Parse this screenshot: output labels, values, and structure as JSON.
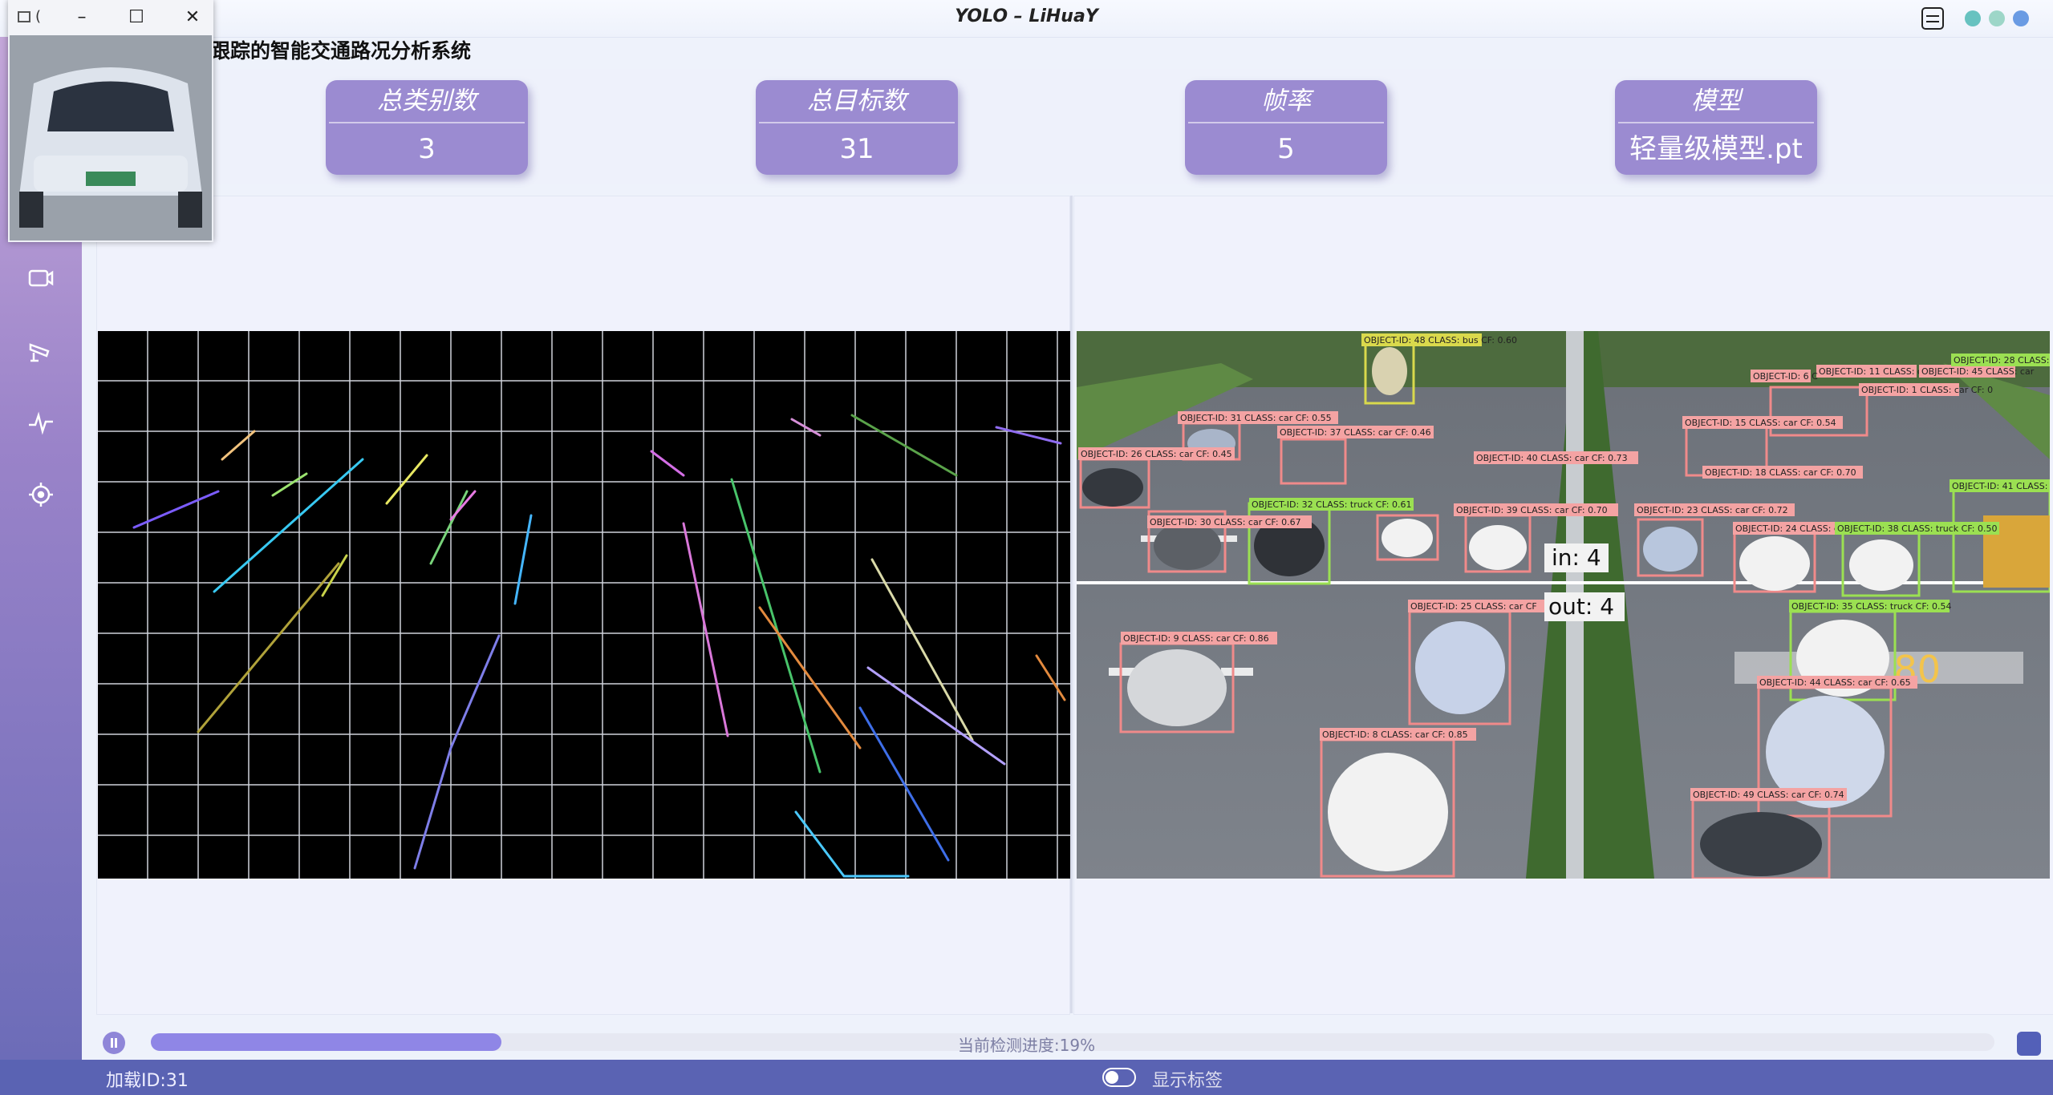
{
  "window": {
    "title": "YOLO  –  LiHuaY"
  },
  "header": {
    "subtitle_visible": "跟踪的智能交通路况分析系统"
  },
  "stats": [
    {
      "label": "总类别数",
      "value": "3"
    },
    {
      "label": "总目标数",
      "value": "31"
    },
    {
      "label": "帧率",
      "value": "5"
    },
    {
      "label": "模型",
      "value": "轻量级模型.pt"
    }
  ],
  "detection_view": {
    "counter_in": "in:  4",
    "counter_out": "out:  4",
    "detections": [
      "OBJECT-ID: 48 CLASS: bus CF: 0.60",
      "OBJECT-ID: 31 CLASS: car CF: 0.55",
      "OBJECT-ID: 37 CLASS: car CF: 0.46",
      "OBJECT-ID: 26 CLASS: car CF: 0.45",
      "OBJECT-ID: 40 CLASS: car CF: 0.73",
      "OBJECT-ID: 32 CLASS: truck CF: 0.61",
      "OBJECT-ID: 30 CLASS: car CF: 0.67",
      "OBJECT-ID: 39 CLASS: car CF: 0.70",
      "OBJECT-ID: 15 CLASS: car CF: 0.54",
      "OBJECT-ID: 18 CLASS: car CF: 0.70",
      "OBJECT-ID: 23 CLASS: car CF: 0.72",
      "OBJECT-ID: 24 CLASS: car",
      "OBJECT-ID: 38 CLASS: truck CF: 0.50",
      "OBJECT-ID: 41 CLASS:",
      "OBJECT-ID: 25 CLASS: car CF",
      "OBJECT-ID: 9 CLASS: car CF: 0.86",
      "OBJECT-ID: 35 CLASS: truck CF: 0.54",
      "OBJECT-ID: 44 CLASS: car CF: 0.65",
      "OBJECT-ID: 8 CLASS: car CF: 0.85",
      "OBJECT-ID: 49 CLASS: car CF: 0.74",
      "OBJECT-ID: 11 CLASS: car",
      "OBJECT-ID: 45 CLASS: car",
      "OBJECT-ID: 1 CLASS: car CF: 0",
      "OBJECT-ID: 28 CLASS:",
      "OBJECT-ID: 6 C"
    ]
  },
  "progress": {
    "text": "当前检测进度:19%",
    "percent": 19
  },
  "statusbar": {
    "left": "加载ID:31",
    "toggle_label": "显示标签"
  },
  "floating_window": {
    "title": "("
  },
  "icons": {
    "sidebar": [
      "camera-icon",
      "cctv-icon",
      "waveform-icon",
      "target-icon"
    ]
  },
  "colors": {
    "accent": "#9b8bd1",
    "statusbar": "#5a63b3",
    "progress": "#8f86e6"
  }
}
